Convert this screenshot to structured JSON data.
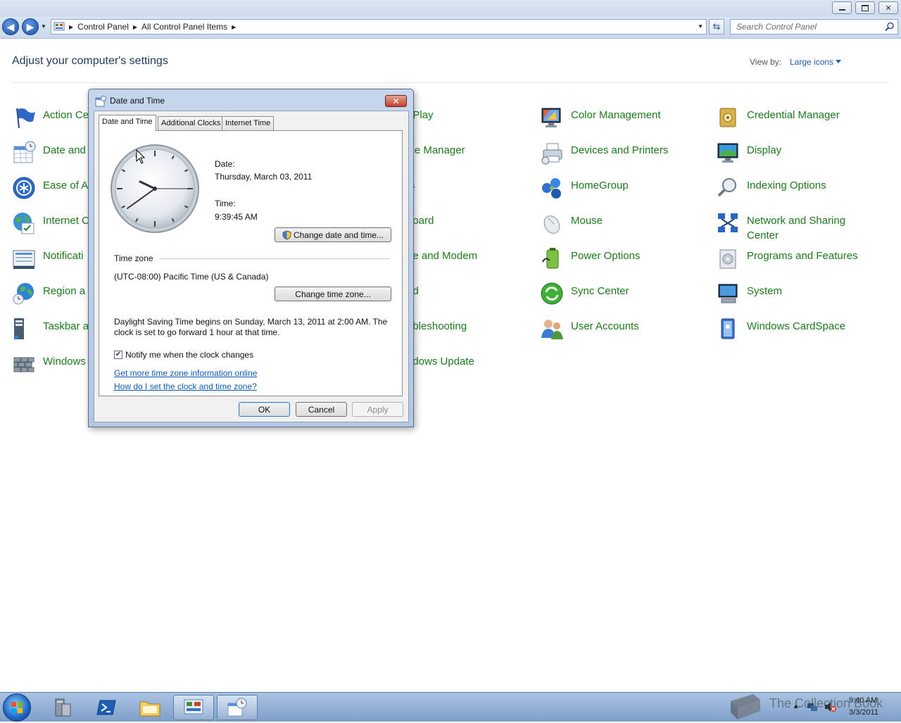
{
  "window": {
    "minimize_label": "minimize",
    "maximize_label": "restore",
    "close_label": "close"
  },
  "navbar": {
    "breadcrumbs": [
      "Control Panel",
      "All Control Panel Items"
    ],
    "search_placeholder": "Search Control Panel"
  },
  "header": {
    "title": "Adjust your computer's settings",
    "view_by_label": "View by:",
    "view_by_value": "Large icons"
  },
  "items": [
    {
      "label": "Action Ce",
      "icon": "flag-icon"
    },
    {
      "label": "Date and",
      "icon": "calendar-clock-icon"
    },
    {
      "label": "Ease of A",
      "icon": "ease-of-access-icon"
    },
    {
      "label": "Internet C",
      "icon": "internet-options-icon"
    },
    {
      "label": "Notificati",
      "icon": "notification-area-icon"
    },
    {
      "label": "Region a",
      "icon": "globe-clock-icon"
    },
    {
      "label": "Taskbar a",
      "icon": "taskbar-icon"
    },
    {
      "label": "Windows",
      "icon": "firewall-icon"
    },
    {
      "label": "oPlay",
      "icon": ""
    },
    {
      "label": "ice Manager",
      "icon": ""
    },
    {
      "label": "ts",
      "icon": ""
    },
    {
      "label": "board",
      "icon": ""
    },
    {
      "label": "ne and Modem",
      "icon": ""
    },
    {
      "label": "nd",
      "icon": ""
    },
    {
      "label": "ubleshooting",
      "icon": ""
    },
    {
      "label": "ndows Update",
      "icon": ""
    },
    {
      "label": "Color Management",
      "icon": "color-management-icon"
    },
    {
      "label": "Devices and Printers",
      "icon": "printer-icon"
    },
    {
      "label": "HomeGroup",
      "icon": "homegroup-icon"
    },
    {
      "label": "Mouse",
      "icon": "mouse-icon"
    },
    {
      "label": "Power Options",
      "icon": "battery-icon"
    },
    {
      "label": "Sync Center",
      "icon": "sync-icon"
    },
    {
      "label": "User Accounts",
      "icon": "users-icon"
    },
    {
      "label": "Credential Manager",
      "icon": "vault-icon"
    },
    {
      "label": "Display",
      "icon": "monitor-icon"
    },
    {
      "label": "Indexing Options",
      "icon": "magnifier-icon"
    },
    {
      "label": "Network and Sharing Center",
      "icon": "network-icon"
    },
    {
      "label": "Programs and Features",
      "icon": "programs-icon"
    },
    {
      "label": "System",
      "icon": "computer-icon"
    },
    {
      "label": "Windows CardSpace",
      "icon": "cardspace-icon"
    }
  ],
  "dialog": {
    "title": "Date and Time",
    "tabs": [
      "Date and Time",
      "Additional Clocks",
      "Internet Time"
    ],
    "date_label": "Date:",
    "date_value": "Thursday, March 03, 2011",
    "time_label": "Time:",
    "time_value": "9:39:45 AM",
    "change_datetime_button": "Change date and time...",
    "timezone_heading": "Time zone",
    "timezone_value": "(UTC-08:00) Pacific Time (US & Canada)",
    "change_timezone_button": "Change time zone...",
    "dst_line1": "Daylight Saving Time begins on Sunday, March 13, 2011 at 2:00 AM. The",
    "dst_line2": "clock is set to go forward 1 hour at that time.",
    "notify_checkbox_label": "Notify me when the clock changes",
    "notify_checked": true,
    "link_more_info": "Get more time zone information online",
    "link_how_to": "How do I set the clock and time zone?",
    "ok_button": "OK",
    "cancel_button": "Cancel",
    "apply_button": "Apply"
  },
  "taskbar": {
    "clock_time": "9:40 AM",
    "clock_date": "3/3/2011",
    "watermark": "The Collection Book"
  }
}
